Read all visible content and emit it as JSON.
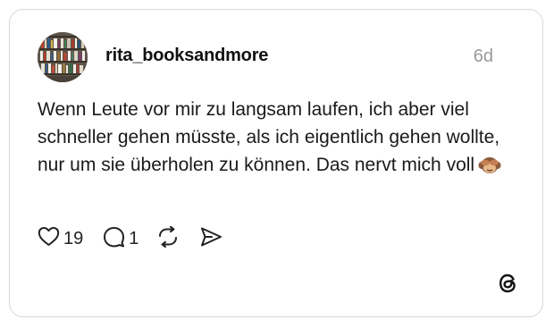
{
  "post": {
    "username": "rita_booksandmore",
    "timestamp": "6d",
    "text": "Wenn Leute vor mir zu langsam laufen, ich aber viel schneller gehen müsste, als ich eigentlich gehen wollte, nur um sie überholen zu können. Das nervt mich voll",
    "emoji": "see-no-evil-monkey",
    "likes": "19",
    "replies": "1"
  },
  "icons": {
    "like": "heart-icon",
    "reply": "comment-icon",
    "repost": "repost-icon",
    "share": "share-icon",
    "logo": "threads-logo"
  },
  "colors": {
    "text": "#1a1a1a",
    "muted": "#999999",
    "border": "#d9d9d9"
  }
}
